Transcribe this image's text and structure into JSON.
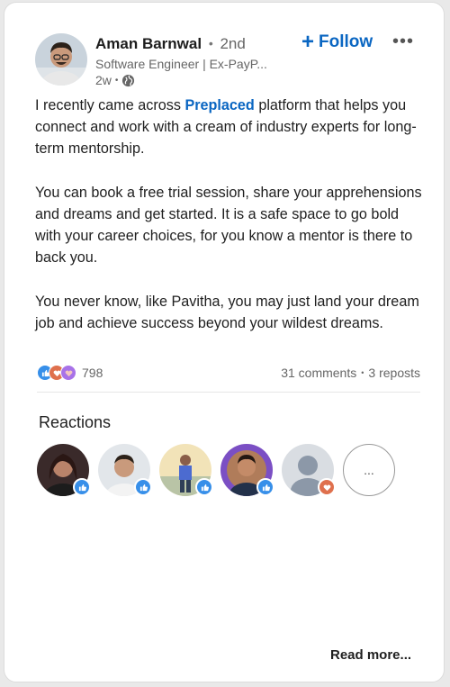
{
  "author": {
    "name": "Aman Barnwal",
    "separator": "•",
    "degree": "2nd",
    "headline": "Software Engineer | Ex-PayP...",
    "time": "2w",
    "visibility_icon": "globe-icon"
  },
  "actions": {
    "follow_plus": "+",
    "follow_label": "Follow",
    "more_label": "•••"
  },
  "post": {
    "para1_before": "I recently came across ",
    "para1_link": "Preplaced",
    "para1_after": " platform that helps you connect and work with a cream of industry experts for long-term mentorship.",
    "para2": "You can book a free trial session, share your apprehensions and dreams and get started. It is a safe space to go bold with your career choices, for you know a mentor is there to back you.",
    "para3": "You never know, like Pavitha, you may just land your dream job and achieve success beyond your wildest dreams."
  },
  "social": {
    "reaction_icons": [
      "like-icon",
      "love-icon",
      "support-icon"
    ],
    "reaction_count": "798",
    "comments": "31 comments",
    "separator": "•",
    "reposts": "3 reposts"
  },
  "reactions": {
    "title": "Reactions",
    "people": [
      {
        "reaction": "like-icon"
      },
      {
        "reaction": "like-icon"
      },
      {
        "reaction": "like-icon"
      },
      {
        "reaction": "like-icon"
      },
      {
        "reaction": "love-icon"
      }
    ],
    "more_label": "..."
  },
  "footer": {
    "read_more": "Read more..."
  },
  "colors": {
    "link_blue": "#0a66c2",
    "like_blue": "#378fe9",
    "love_red": "#df704d"
  }
}
